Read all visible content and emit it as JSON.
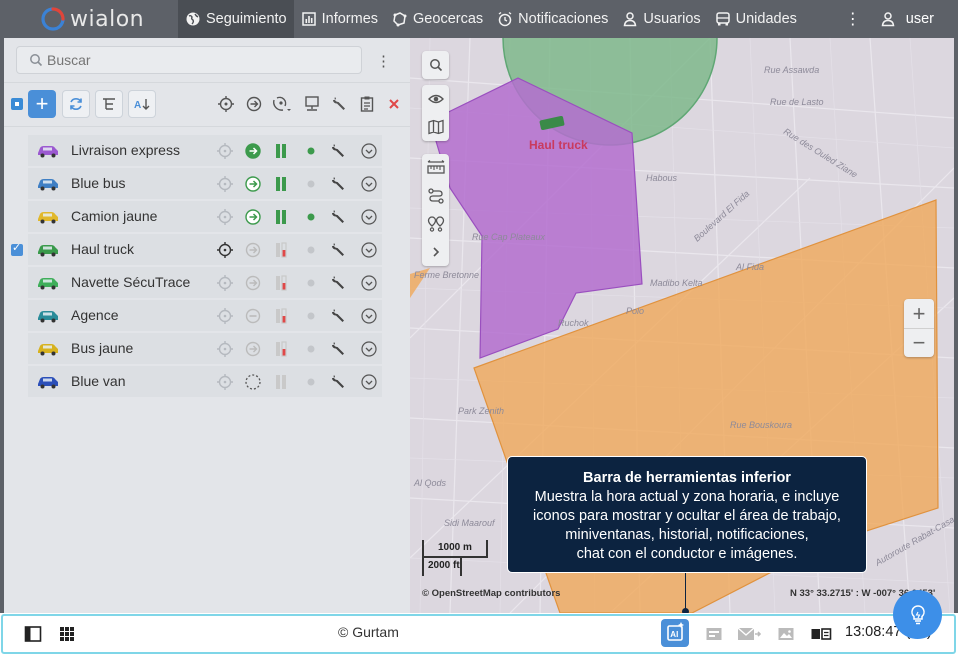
{
  "header": {
    "logo_text": "wialon",
    "nav": [
      {
        "label": "Seguimiento",
        "icon": "globe-icon",
        "active": true
      },
      {
        "label": "Informes",
        "icon": "report-chart-icon",
        "active": false
      },
      {
        "label": "Geocercas",
        "icon": "geofence-icon",
        "active": false
      },
      {
        "label": "Notificaciones",
        "icon": "alarm-clock-icon",
        "active": false
      },
      {
        "label": "Usuarios",
        "icon": "user-outline-icon",
        "active": false
      },
      {
        "label": "Unidades",
        "icon": "bus-icon",
        "active": false
      }
    ],
    "user_label": "user"
  },
  "panel": {
    "search_placeholder": "Buscar",
    "units": [
      {
        "name": "Livraison express",
        "checked": false,
        "icon": "purple-car-icon",
        "color": "#9b59d0",
        "motion": "moving",
        "ignition": "on",
        "status": "green"
      },
      {
        "name": "Blue bus",
        "checked": false,
        "icon": "blue-bus-icon",
        "color": "#3f7fc4",
        "motion": "moving",
        "ignition": "on",
        "status": "grey"
      },
      {
        "name": "Camion jaune",
        "checked": false,
        "icon": "yellow-truck-icon",
        "color": "#e1b82b",
        "motion": "moving",
        "ignition": "on",
        "status": "green"
      },
      {
        "name": "Haul truck",
        "checked": true,
        "icon": "green-truck-icon",
        "color": "#3a9a4b",
        "motion": "stopped",
        "ignition": "low",
        "status": "grey"
      },
      {
        "name": "Navette SécuTrace",
        "checked": false,
        "icon": "green-bus-icon",
        "color": "#3fae5a",
        "motion": "stopped",
        "ignition": "low",
        "status": "grey"
      },
      {
        "name": "Agence",
        "checked": false,
        "icon": "teal-car-icon",
        "color": "#2a8c9a",
        "motion": "parked",
        "ignition": "low",
        "status": "grey"
      },
      {
        "name": "Bus jaune",
        "checked": false,
        "icon": "yellow-bus-icon",
        "color": "#d7b21e",
        "motion": "stopped",
        "ignition": "low",
        "status": "grey"
      },
      {
        "name": "Blue van",
        "checked": false,
        "icon": "blue-van-icon",
        "color": "#2b4fb8",
        "motion": "unknown",
        "ignition": "off",
        "status": "grey"
      }
    ]
  },
  "map": {
    "unit_label": "Haul truck",
    "streets": [
      "Rue Assawda",
      "Rue de Lasto",
      "Habous",
      "Rue des Ouled Ziane",
      "Boulevard El Fida",
      "Al Fida",
      "Rue Cap Plateaux",
      "Ferme Bretonne",
      "Madibo Kelta",
      "Polo",
      "Ruchok",
      "Park Zenith",
      "Al Qods",
      "Sidi Maarouf",
      "Autoroute Rabat-Casa",
      "Rue Bouskoura"
    ],
    "scale_metric": "1000 m",
    "scale_imperial": "2000 ft",
    "attribution": "© OpenStreetMap contributors",
    "coordinates": "N 33° 33.2715' : W -007° 36.0453'"
  },
  "tooltip": {
    "title": "Barra de herramientas inferior",
    "lines": [
      "Muestra la hora actual y zona horaria, e incluye",
      "iconos para mostrar y ocultar el área de trabajo,",
      "miniventanas, historial, notificaciones,",
      "chat con el conductor e imágenes."
    ]
  },
  "bottom": {
    "copyright": "© Gurtam",
    "clock": "13:08:47 (+0)"
  },
  "colors": {
    "accent": "#4a8fd8",
    "header_bg": "#5d6168",
    "geofence_green": "#5fa774",
    "geofence_purple": "#a55bc6",
    "geofence_orange": "#f0a95a",
    "tooltip_bg": "#0c2340",
    "fab": "#3d8fe8"
  }
}
